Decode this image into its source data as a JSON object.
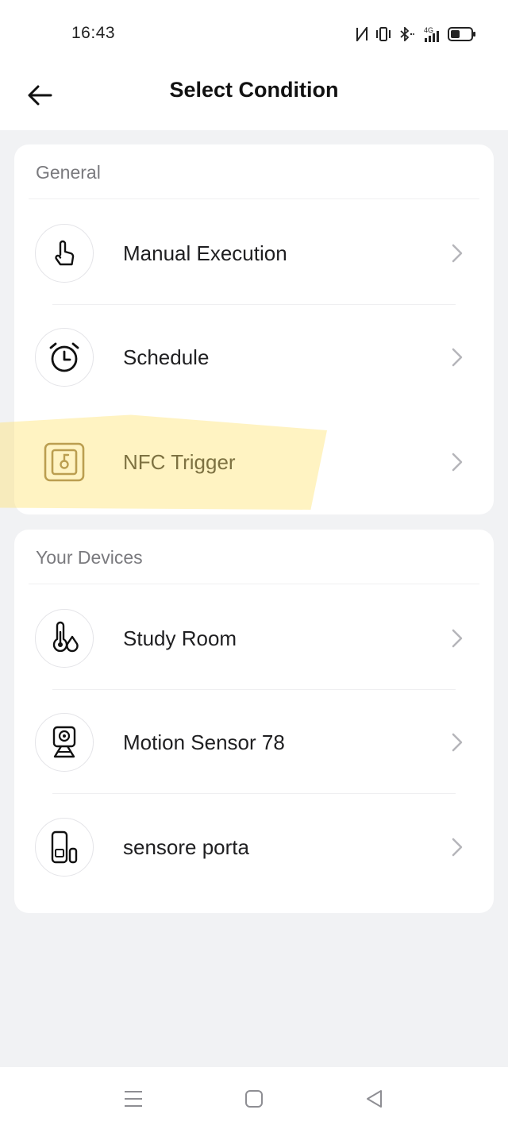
{
  "status_bar": {
    "time": "16:43",
    "icons": [
      "nfc-icon",
      "vibrate-icon",
      "bluetooth-icon",
      "signal-4g-icon",
      "battery-icon"
    ],
    "network_label": "4G"
  },
  "header": {
    "title": "Select Condition",
    "back_icon": "arrow-left-icon"
  },
  "sections": {
    "general": {
      "title": "General",
      "items": [
        {
          "label": "Manual Execution",
          "icon": "hand-tap-icon"
        },
        {
          "label": "Schedule",
          "icon": "alarm-clock-icon"
        },
        {
          "label": "NFC Trigger",
          "icon": "nfc-tag-icon"
        }
      ]
    },
    "devices": {
      "title": "Your Devices",
      "items": [
        {
          "label": "Study Room",
          "icon": "thermometer-humidity-icon"
        },
        {
          "label": "Motion Sensor 78",
          "icon": "motion-sensor-icon"
        },
        {
          "label": "sensore porta",
          "icon": "door-sensor-icon"
        }
      ]
    }
  },
  "nav_bar": {
    "icons": [
      "menu-icon",
      "home-square-icon",
      "back-triangle-icon"
    ]
  },
  "colors": {
    "background": "#f1f2f4",
    "card": "#ffffff",
    "highlight": "#ffe26e",
    "icon_gold": "#8a6d3b",
    "chevron": "#b5b5ba"
  }
}
